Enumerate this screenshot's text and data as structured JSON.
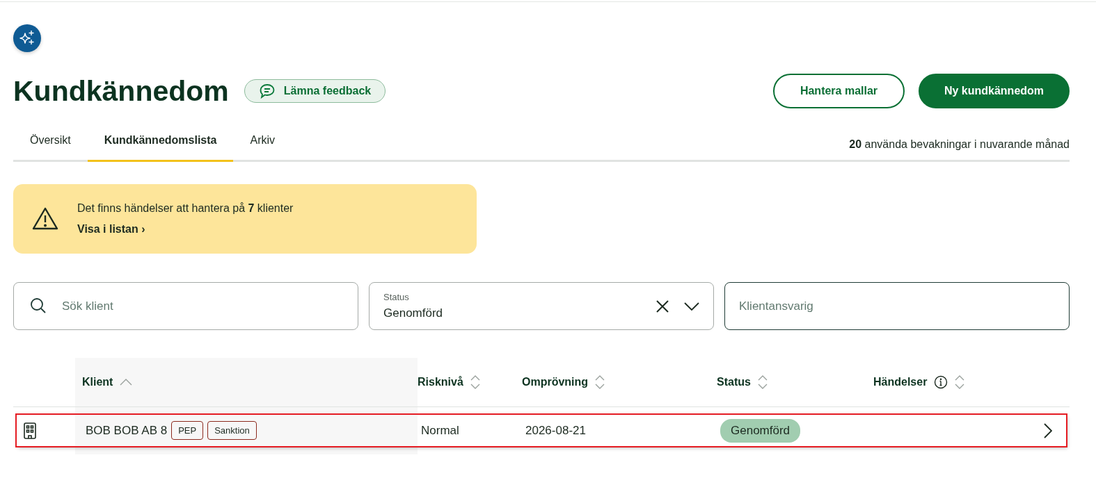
{
  "header": {
    "title": "Kundkännedom",
    "feedback_button": "Lämna feedback",
    "actions": [
      {
        "label": "Hantera mallar",
        "kind": "secondary"
      },
      {
        "label": "Ny kundkännedom",
        "kind": "primary"
      }
    ]
  },
  "tabs": [
    {
      "label": "Översikt",
      "selected": false
    },
    {
      "label": "Kundkännedomslista",
      "selected": true
    },
    {
      "label": "Arkiv",
      "selected": false
    }
  ],
  "usage": "**20** använda bevakningar i nuvarande månad",
  "alert": {
    "message": "Det finns händelser att hantera på **7** klienter",
    "link": "Visa i listan ›"
  },
  "filters": {
    "search": {
      "placeholder": "Sök klient"
    },
    "status": {
      "label": "Status",
      "value": "Genomförd"
    },
    "responsible": {
      "placeholder": "Klientansvarig"
    }
  },
  "table": {
    "columns": [
      {
        "label": "Klient",
        "sorted_ascending": true,
        "info": false
      },
      {
        "label": "Risknivå",
        "sorted_ascending": false,
        "info": false
      },
      {
        "label": "Omprövning",
        "sorted_ascending": false,
        "info": false
      },
      {
        "label": "Status",
        "sorted_ascending": false,
        "info": false
      },
      {
        "label": "Händelser",
        "sorted_ascending": false,
        "info": true
      }
    ],
    "rows": [
      {
        "client": "BOB BOB AB 8",
        "tags": [
          "PEP",
          "Sanktion"
        ],
        "risk": "Normal",
        "review": "2026-08-21",
        "status": "Genomförd",
        "highlighted": true
      }
    ]
  }
}
